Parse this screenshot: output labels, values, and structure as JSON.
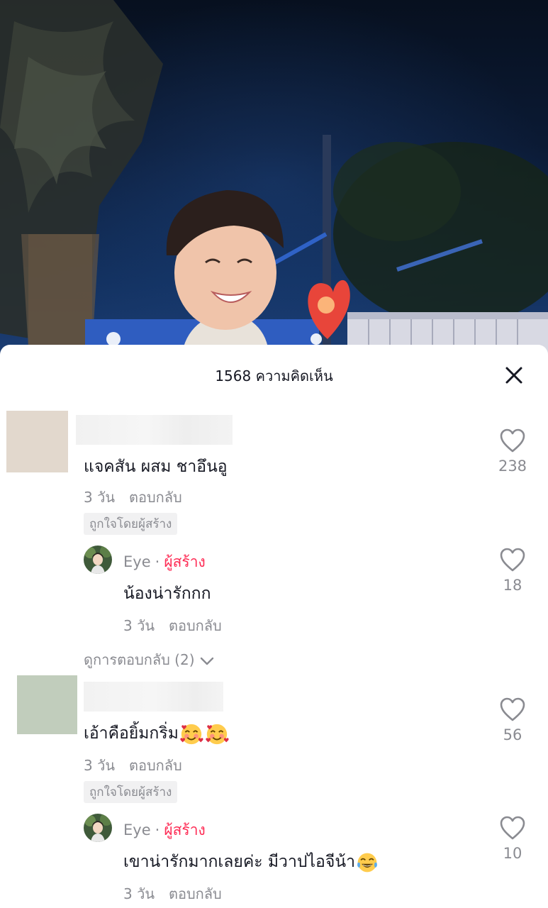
{
  "sheet": {
    "title": "1568 ความคิดเห็น"
  },
  "comments": [
    {
      "text": "แจคสัน ผสม ชาอึนอู",
      "time": "3 วัน",
      "reply_label": "ตอบกลับ",
      "liked_by_creator": "ถูกใจโดยผู้สร้าง",
      "likes": "238",
      "avatar_color": "#e2d8cd",
      "reply": {
        "author": "Eye",
        "separator": "·",
        "author_tag": "ผู้สร้าง",
        "text": "น้องน่ารักกก",
        "time": "3 วัน",
        "reply_label": "ตอบกลับ",
        "likes": "18"
      },
      "view_replies": "ดูการตอบกลับ (2)"
    },
    {
      "text": "เอ้าคือยิ้มกริ่ม",
      "emojis": [
        "smiling-face-with-hearts",
        "smiling-face-with-hearts"
      ],
      "time": "3 วัน",
      "reply_label": "ตอบกลับ",
      "liked_by_creator": "ถูกใจโดยผู้สร้าง",
      "likes": "56",
      "avatar_color": "#c1cdbc",
      "reply": {
        "author": "Eye",
        "separator": "·",
        "author_tag": "ผู้สร้าง",
        "text": "เขาน่ารักมากเลยค่ะ มีวาปไอจีน้า",
        "emojis": [
          "face-with-tears-of-joy"
        ],
        "time": "3 วัน",
        "reply_label": "ตอบกลับ",
        "likes": "10"
      }
    }
  ],
  "colors": {
    "accent": "#fe2c55",
    "secondary_text": "#8a8b91",
    "primary_text": "#161823"
  }
}
